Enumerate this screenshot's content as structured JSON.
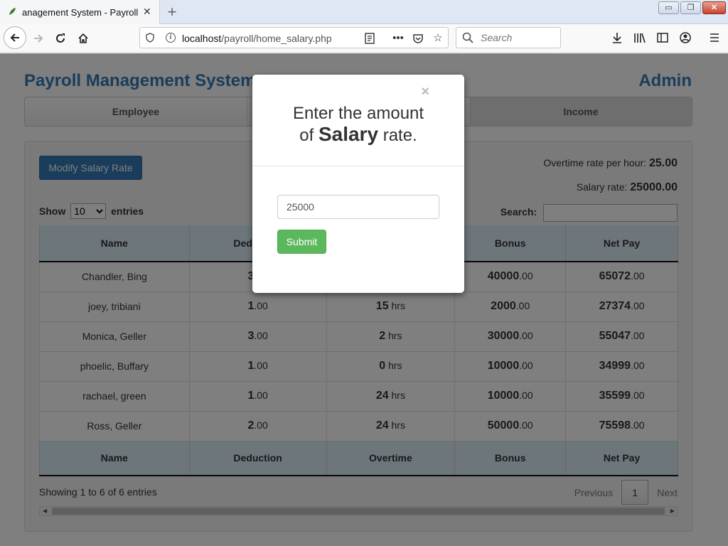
{
  "browser": {
    "tab_title": "anagement System - Payroll M",
    "tab_close": "✕",
    "new_tab": "+",
    "win_minimize": "▭",
    "win_restore": "❐",
    "win_close": "✕",
    "url_host": "localhost",
    "url_path": "/payroll/home_salary.php",
    "search_placeholder": "Search"
  },
  "header": {
    "brand": "Payroll Management System",
    "user": "Admin"
  },
  "nav": {
    "items": [
      "Employee",
      "",
      "Income"
    ]
  },
  "panel": {
    "modify_button": "Modify Salary Rate",
    "overtime_label": "Overtime rate per hour:",
    "overtime_value": "25.00",
    "salary_label": "Salary rate:",
    "salary_value": "25000.00",
    "show_label": "Show",
    "entries_label": "entries",
    "entries_selected": "10",
    "search_label": "Search:"
  },
  "table": {
    "columns": [
      "Name",
      "Deduction",
      "Overtime",
      "Bonus",
      "Net Pay"
    ],
    "rows": [
      {
        "name": "Chandler, Bing",
        "deduction": "3",
        "overtime": "",
        "bonus": "40000",
        "net": "65072"
      },
      {
        "name": "joey, tribiani",
        "deduction": "1",
        "overtime": "15",
        "bonus": "2000",
        "net": "27374"
      },
      {
        "name": "Monica, Geller",
        "deduction": "3",
        "overtime": "2",
        "bonus": "30000",
        "net": "55047"
      },
      {
        "name": "phoelic, Buffary",
        "deduction": "1",
        "overtime": "0",
        "bonus": "10000",
        "net": "34999"
      },
      {
        "name": "rachael, green",
        "deduction": "1",
        "overtime": "24",
        "bonus": "10000",
        "net": "35599"
      },
      {
        "name": "Ross, Geller",
        "deduction": "2",
        "overtime": "24",
        "bonus": "50000",
        "net": "75598"
      }
    ],
    "decimal_suffix": ".00",
    "hours_suffix": "hrs",
    "info": "Showing 1 to 6 of 6 entries",
    "prev": "Previous",
    "page": "1",
    "next": "Next"
  },
  "modal": {
    "close": "×",
    "title_line1": "Enter the amount",
    "title_of": "of",
    "title_bold": "Salary",
    "title_rest": "rate.",
    "input_value": "25000",
    "submit": "Submit"
  }
}
